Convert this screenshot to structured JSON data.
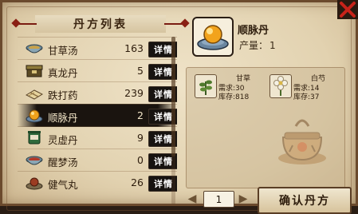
{
  "panel": {
    "title": "丹方列表"
  },
  "recipes": [
    {
      "name": "甘草汤",
      "count": "163",
      "detail": "详情",
      "icon": "bowl-icon"
    },
    {
      "name": "真龙丹",
      "count": "5",
      "detail": "详情",
      "icon": "box-icon"
    },
    {
      "name": "跌打药",
      "count": "239",
      "detail": "详情",
      "icon": "package-icon"
    },
    {
      "name": "顺脉丹",
      "count": "2",
      "detail": "详情",
      "icon": "pill-icon",
      "selected": true
    },
    {
      "name": "灵虚丹",
      "count": "9",
      "detail": "详情",
      "icon": "jar-icon"
    },
    {
      "name": "醒梦汤",
      "count": "0",
      "detail": "详情",
      "icon": "bowl-icon"
    },
    {
      "name": "健气丸",
      "count": "26",
      "detail": "详情",
      "icon": "pill-icon"
    }
  ],
  "product": {
    "name": "顺脉丹",
    "yield_label": "产量：",
    "yield_value": "1"
  },
  "materials": [
    {
      "name": "甘草",
      "required": "需求:30",
      "stock": "库存:818",
      "icon": "herb-icon"
    },
    {
      "name": "白芍",
      "required": "需求:14",
      "stock": "库存:37",
      "icon": "flower-icon"
    }
  ],
  "pager": {
    "page": "1",
    "prev": "◀",
    "next": "▶"
  },
  "actions": {
    "confirm": "确认丹方"
  },
  "colors": {
    "selected_row": "#1a140f",
    "close_red": "#b01e14"
  }
}
